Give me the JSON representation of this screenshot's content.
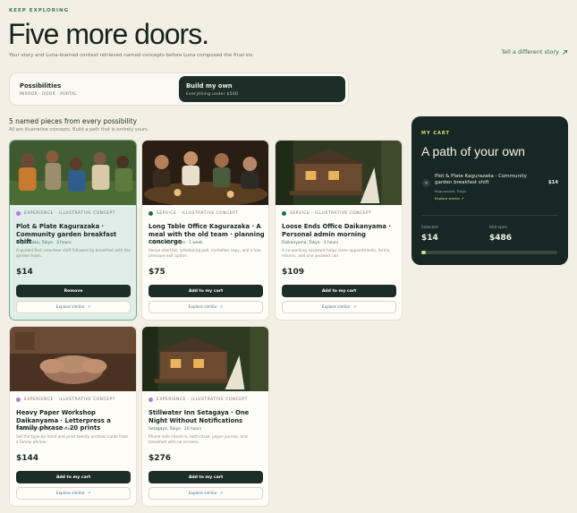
{
  "header": {
    "eyebrow": "KEEP EXPLORING",
    "title": "Five more doors.",
    "subtitle": "Your story and Luna-learned context retrieved named concepts before Luna composed the final six.",
    "tell_link": "Tell a different story"
  },
  "tabs": [
    {
      "title": "Possibilities",
      "sub": "MIRROR · DOOR · PORTAL"
    },
    {
      "title": "Build my own",
      "sub": "Everything under $500"
    }
  ],
  "section": {
    "title": "5 named pieces from every possibility",
    "sub": "All are illustrative concepts. Build a path that is entirely yours."
  },
  "cards": [
    {
      "kind": "EXPERIENCE · ILLUSTRATIVE CONCEPT",
      "kind_color": "#b07ad8",
      "title": "Plot & Plate Kagurazaka · Community garden breakfast shift",
      "loc": "Kagurazaka, Tokyo · 3 hours",
      "desc": "A guided first volunteer shift followed by breakfast with the garden team.",
      "price": "$14",
      "primary": "Remove",
      "secondary": "Explore similar"
    },
    {
      "kind": "SERVICE · ILLUSTRATIVE CONCEPT",
      "kind_color": "#1f6b55",
      "title": "Long Table Office Kagurazaka · A meal with the old team · planning concierge",
      "loc": "Kagurazaka, Tokyo · 1 week",
      "desc": "Venue shortlist, scheduling poll, invitation copy, and a low-pressure exit option.",
      "price": "$75",
      "primary": "Add to my cart",
      "secondary": "Explore similar"
    },
    {
      "kind": "SERVICE · ILLUSTRATIVE CONCEPT",
      "kind_color": "#1f6b55",
      "title": "Loose Ends Office Daikanyama · Personal admin morning",
      "loc": "Daikanyama, Tokyo · 3 hours",
      "desc": "A co-working assistant helps close appointments, forms, returns, and one avoided call.",
      "price": "$109",
      "primary": "Add to my cart",
      "secondary": "Explore similar"
    },
    {
      "kind": "EXPERIENCE · ILLUSTRATIVE CONCEPT",
      "kind_color": "#b07ad8",
      "title": "Heavy Paper Workshop Daikanyama · Letterpress a family phrase · 20 prints",
      "loc": "Daikanyama, Tokyo · 3 hours",
      "desc": "Set the type by hand and print twenty archival cards from a family phrase.",
      "price": "$144",
      "primary": "Add to my cart",
      "secondary": "Explore similar"
    },
    {
      "kind": "EXPERIENCE · ILLUSTRATIVE CONCEPT",
      "kind_color": "#b07ad8",
      "title": "Stillwater Inn Setagaya · One Night Without Notifications",
      "loc": "Setagaya, Tokyo · 20 hours",
      "desc": "Phone-safe check-in, bath ritual, paper journal, and breakfast with no screens.",
      "price": "$276",
      "primary": "Add to my cart",
      "secondary": "Explore similar"
    }
  ],
  "cart": {
    "label": "MY CART",
    "title": "A path of your own",
    "item": {
      "title": "Plot & Plate Kagurazaka · Community garden breakfast shift",
      "loc": "Kagurazaka, Tokyo",
      "explore": "Explore similar",
      "price": "$14"
    },
    "selected_label": "Selected",
    "selected_value": "$14",
    "open_label": "Still open",
    "open_value": "$486",
    "progress": 0.028
  },
  "colors": {
    "accent_dark": "#1d2d27",
    "accent_lime": "#cfe27a",
    "background": "#f3efe5"
  }
}
